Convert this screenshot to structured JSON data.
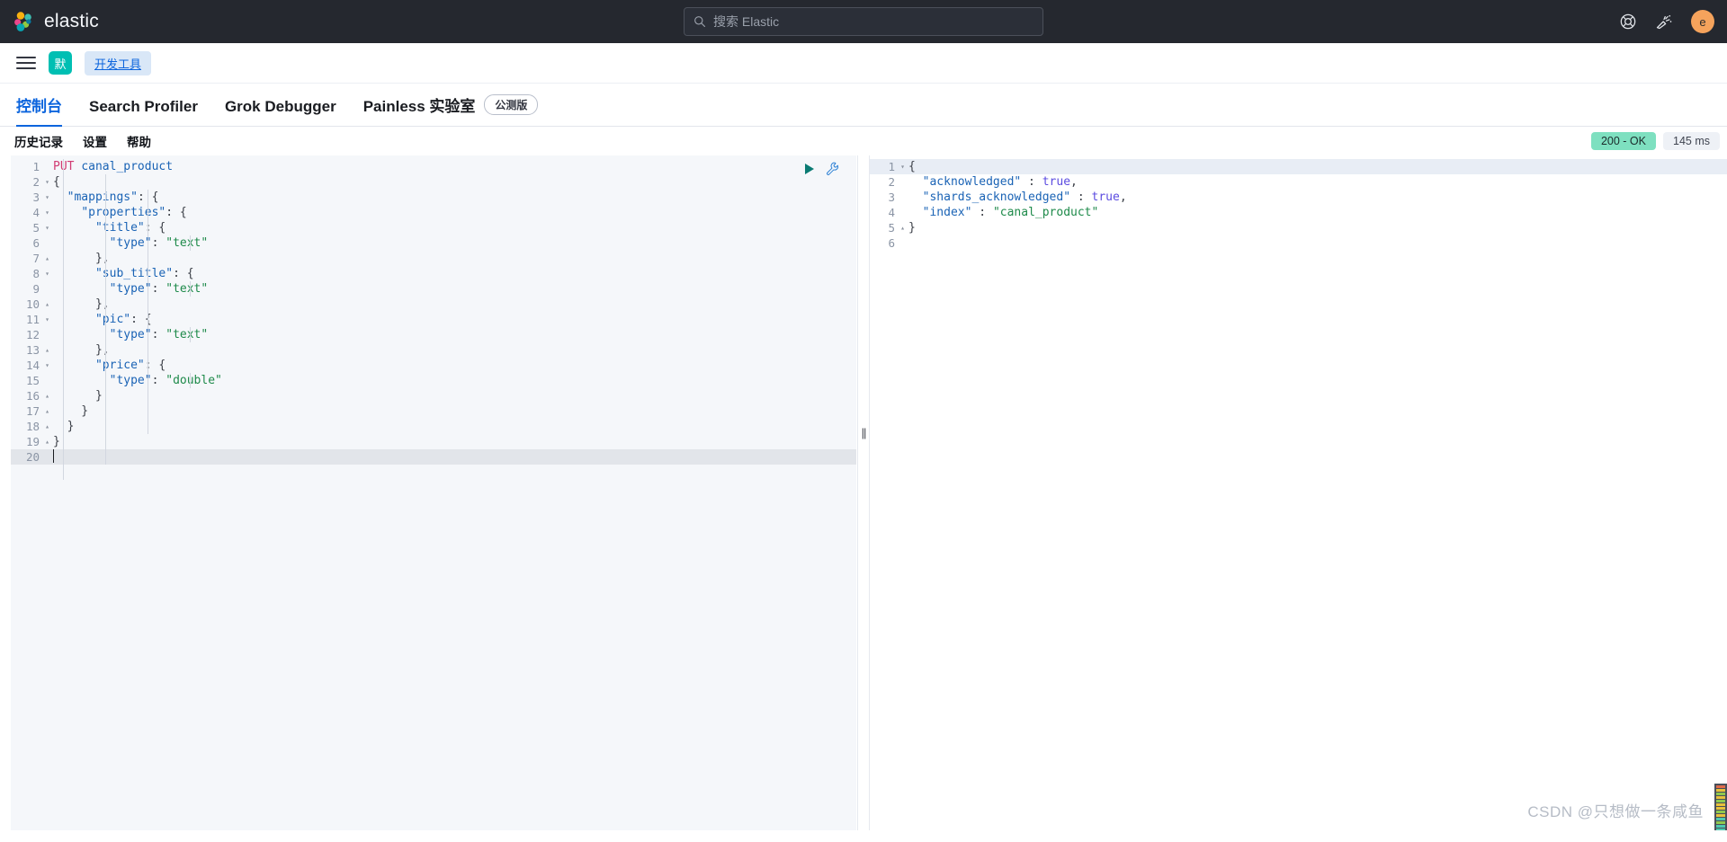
{
  "header": {
    "brand": "elastic",
    "search_placeholder": "搜索 Elastic",
    "icons": {
      "search": "search-icon",
      "help": "lifebuoy-help-icon",
      "news": "announcement-icon"
    },
    "avatar_initial": "e"
  },
  "secondary_nav": {
    "menu_icon": "hamburger-menu-icon",
    "space_badge": "默",
    "breadcrumb": "开发工具"
  },
  "tabs": [
    {
      "label": "控制台",
      "active": true,
      "badge": null
    },
    {
      "label": "Search Profiler",
      "active": false,
      "badge": null
    },
    {
      "label": "Grok Debugger",
      "active": false,
      "badge": null
    },
    {
      "label": "Painless 实验室",
      "active": false,
      "badge": "公测版"
    }
  ],
  "sub_toolbar": {
    "links": [
      "历史记录",
      "设置",
      "帮助"
    ],
    "status_code": "200 - OK",
    "status_time": "145 ms",
    "status_color": "#7ee0c0"
  },
  "editor": {
    "play_icon": "play-send-request-icon",
    "wrench_icon": "wrench-settings-icon",
    "active_line": 20,
    "lines": [
      {
        "n": 1,
        "fold": "",
        "tokens": [
          {
            "t": "PUT",
            "c": "t-method"
          },
          {
            "t": " ",
            "c": "t-punct"
          },
          {
            "t": "canal_product",
            "c": "t-url"
          }
        ]
      },
      {
        "n": 2,
        "fold": "▾",
        "tokens": [
          {
            "t": "{",
            "c": "t-punct"
          }
        ]
      },
      {
        "n": 3,
        "fold": "▾",
        "tokens": [
          {
            "t": "  ",
            "c": "t-punct"
          },
          {
            "t": "\"mappings\"",
            "c": "t-key"
          },
          {
            "t": ": {",
            "c": "t-punct"
          }
        ]
      },
      {
        "n": 4,
        "fold": "▾",
        "tokens": [
          {
            "t": "    ",
            "c": "t-punct"
          },
          {
            "t": "\"properties\"",
            "c": "t-key"
          },
          {
            "t": ": {",
            "c": "t-punct"
          }
        ]
      },
      {
        "n": 5,
        "fold": "▾",
        "tokens": [
          {
            "t": "      ",
            "c": "t-punct"
          },
          {
            "t": "\"title\"",
            "c": "t-key"
          },
          {
            "t": ": {",
            "c": "t-punct"
          }
        ]
      },
      {
        "n": 6,
        "fold": "",
        "tokens": [
          {
            "t": "        ",
            "c": "t-punct"
          },
          {
            "t": "\"type\"",
            "c": "t-key"
          },
          {
            "t": ": ",
            "c": "t-punct"
          },
          {
            "t": "\"text\"",
            "c": "t-str"
          }
        ]
      },
      {
        "n": 7,
        "fold": "▴",
        "tokens": [
          {
            "t": "      },",
            "c": "t-punct"
          }
        ]
      },
      {
        "n": 8,
        "fold": "▾",
        "tokens": [
          {
            "t": "      ",
            "c": "t-punct"
          },
          {
            "t": "\"sub_title\"",
            "c": "t-key"
          },
          {
            "t": ": {",
            "c": "t-punct"
          }
        ]
      },
      {
        "n": 9,
        "fold": "",
        "tokens": [
          {
            "t": "        ",
            "c": "t-punct"
          },
          {
            "t": "\"type\"",
            "c": "t-key"
          },
          {
            "t": ": ",
            "c": "t-punct"
          },
          {
            "t": "\"text\"",
            "c": "t-str"
          }
        ]
      },
      {
        "n": 10,
        "fold": "▴",
        "tokens": [
          {
            "t": "      },",
            "c": "t-punct"
          }
        ]
      },
      {
        "n": 11,
        "fold": "▾",
        "tokens": [
          {
            "t": "      ",
            "c": "t-punct"
          },
          {
            "t": "\"pic\"",
            "c": "t-key"
          },
          {
            "t": ": {",
            "c": "t-punct"
          }
        ]
      },
      {
        "n": 12,
        "fold": "",
        "tokens": [
          {
            "t": "        ",
            "c": "t-punct"
          },
          {
            "t": "\"type\"",
            "c": "t-key"
          },
          {
            "t": ": ",
            "c": "t-punct"
          },
          {
            "t": "\"text\"",
            "c": "t-str"
          }
        ]
      },
      {
        "n": 13,
        "fold": "▴",
        "tokens": [
          {
            "t": "      },",
            "c": "t-punct"
          }
        ]
      },
      {
        "n": 14,
        "fold": "▾",
        "tokens": [
          {
            "t": "      ",
            "c": "t-punct"
          },
          {
            "t": "\"price\"",
            "c": "t-key"
          },
          {
            "t": ": {",
            "c": "t-punct"
          }
        ]
      },
      {
        "n": 15,
        "fold": "",
        "tokens": [
          {
            "t": "        ",
            "c": "t-punct"
          },
          {
            "t": "\"type\"",
            "c": "t-key"
          },
          {
            "t": ": ",
            "c": "t-punct"
          },
          {
            "t": "\"double\"",
            "c": "t-str"
          }
        ]
      },
      {
        "n": 16,
        "fold": "▴",
        "tokens": [
          {
            "t": "      }",
            "c": "t-punct"
          }
        ]
      },
      {
        "n": 17,
        "fold": "▴",
        "tokens": [
          {
            "t": "    }",
            "c": "t-punct"
          }
        ]
      },
      {
        "n": 18,
        "fold": "▴",
        "tokens": [
          {
            "t": "  }",
            "c": "t-punct"
          }
        ]
      },
      {
        "n": 19,
        "fold": "▴",
        "tokens": [
          {
            "t": "}",
            "c": "t-punct"
          }
        ]
      },
      {
        "n": 20,
        "fold": "",
        "tokens": []
      }
    ]
  },
  "response": {
    "active_line": 1,
    "lines": [
      {
        "n": 1,
        "fold": "▾",
        "tokens": [
          {
            "t": "{",
            "c": "t-punct"
          }
        ]
      },
      {
        "n": 2,
        "fold": "",
        "tokens": [
          {
            "t": "  ",
            "c": "t-punct"
          },
          {
            "t": "\"acknowledged\"",
            "c": "t-key"
          },
          {
            "t": " : ",
            "c": "t-punct"
          },
          {
            "t": "true",
            "c": "t-bool"
          },
          {
            "t": ",",
            "c": "t-punct"
          }
        ]
      },
      {
        "n": 3,
        "fold": "",
        "tokens": [
          {
            "t": "  ",
            "c": "t-punct"
          },
          {
            "t": "\"shards_acknowledged\"",
            "c": "t-key"
          },
          {
            "t": " : ",
            "c": "t-punct"
          },
          {
            "t": "true",
            "c": "t-bool"
          },
          {
            "t": ",",
            "c": "t-punct"
          }
        ]
      },
      {
        "n": 4,
        "fold": "",
        "tokens": [
          {
            "t": "  ",
            "c": "t-punct"
          },
          {
            "t": "\"index\"",
            "c": "t-key"
          },
          {
            "t": " : ",
            "c": "t-punct"
          },
          {
            "t": "\"canal_product\"",
            "c": "t-str"
          }
        ]
      },
      {
        "n": 5,
        "fold": "▴",
        "tokens": [
          {
            "t": "}",
            "c": "t-punct"
          }
        ]
      },
      {
        "n": 6,
        "fold": "",
        "tokens": []
      }
    ]
  },
  "resizer": {
    "grip": "||"
  },
  "watermark": "CSDN @只想做一条咸鱼"
}
